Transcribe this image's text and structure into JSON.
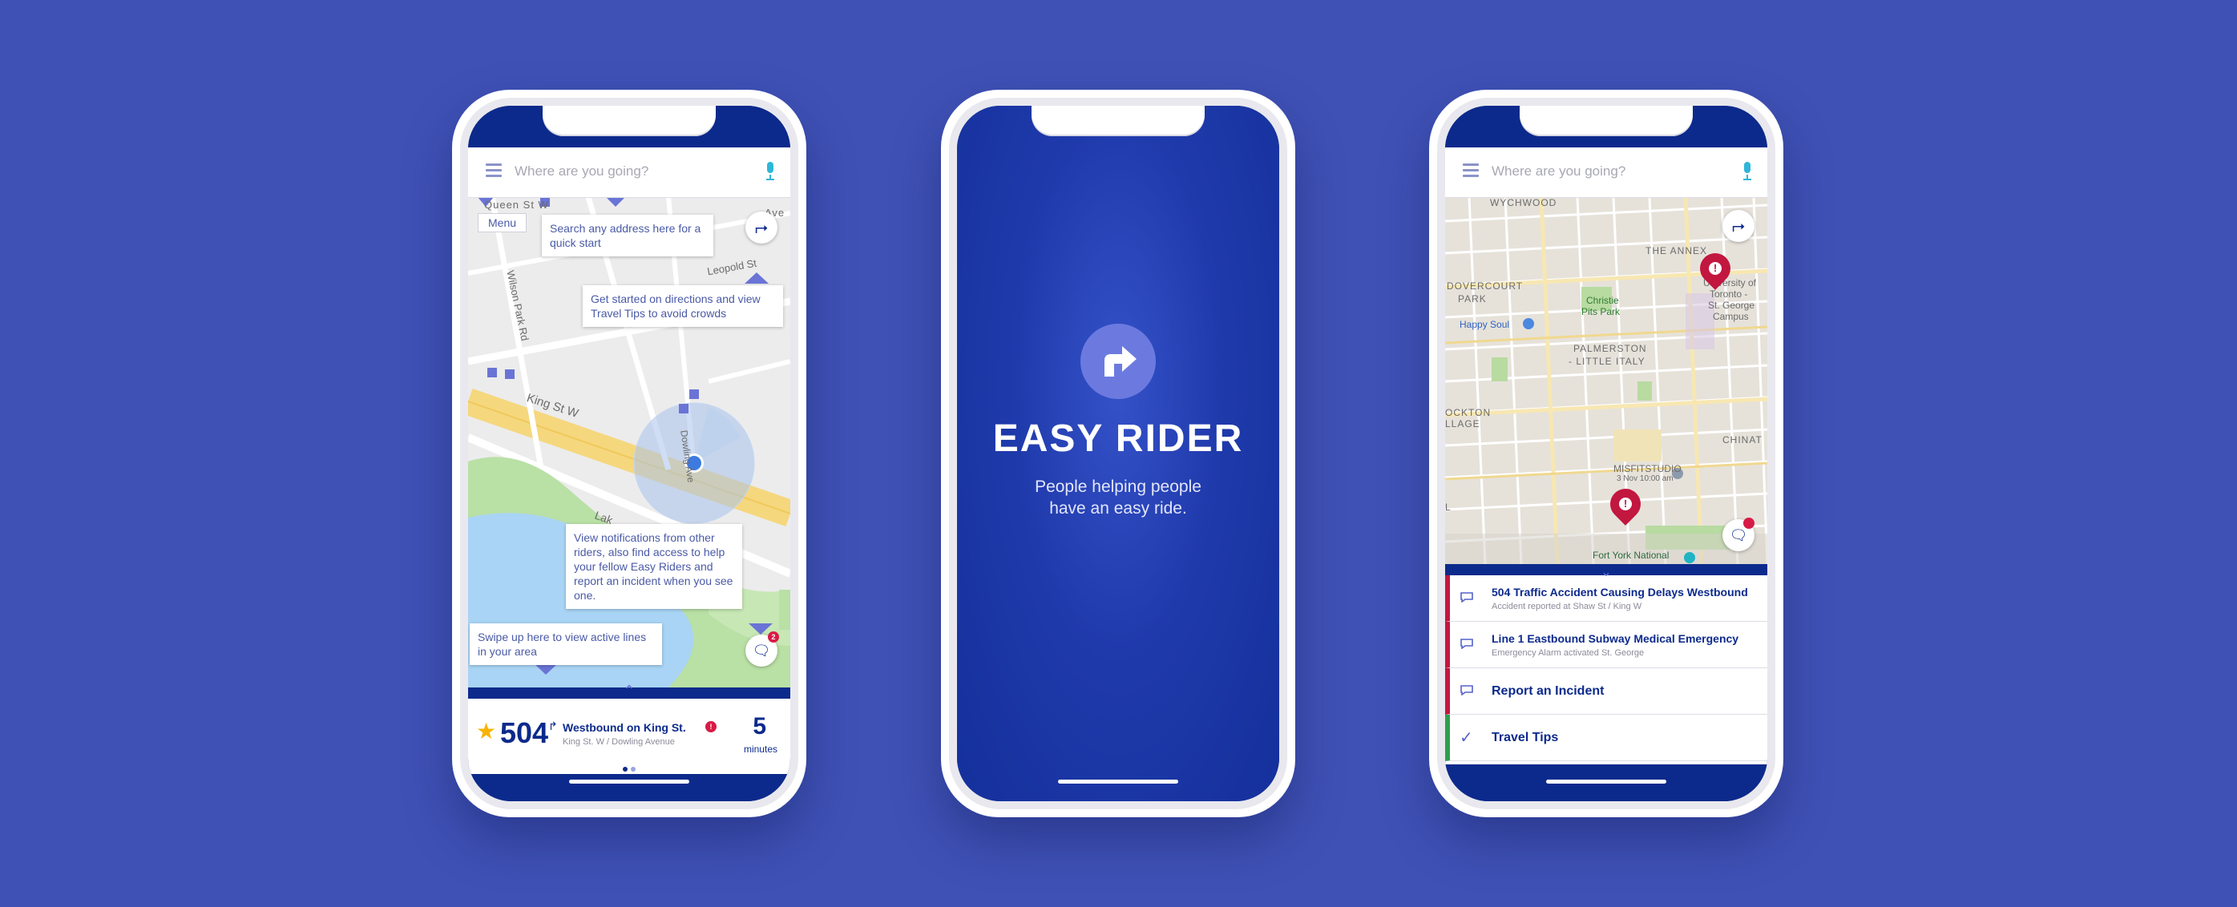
{
  "search": {
    "placeholder": "Where are you going?"
  },
  "phone1": {
    "menu_chip": "Menu",
    "tips": {
      "search": "Search any address here for a quick start",
      "directions": "Get started on directions and view Travel Tips to avoid crowds",
      "notifications": "View notifications from other riders, also find access to help your fellow Easy Riders and report an incident when you see one.",
      "swipe": "Swipe up here to view active lines in your area"
    },
    "streets": {
      "king": "King St W",
      "wilson": "Wilson Park Rd",
      "leopold": "Leopold St",
      "dowling": "Dowling Ave",
      "lake": "Lak",
      "queen": "Queen St W",
      "ave": "Ave"
    },
    "chat_badge": "2",
    "route": {
      "number": "504",
      "direction": "Westbound on King St.",
      "alert": "!",
      "stop": "King St. W / Dowling Avenue",
      "minutes": "5",
      "minutes_label": "minutes"
    }
  },
  "splash": {
    "brand": "EASY RIDER",
    "tagline_line1": "People helping people",
    "tagline_line2": "have an easy ride."
  },
  "phone3": {
    "map_labels": {
      "wychwood": "WYCHWOOD",
      "annex": "THE ANNEX",
      "dovercourt1": "DOVERCOURT",
      "dovercourt2": "PARK",
      "christie1": "Christie",
      "christie2": "Pits Park",
      "happy": "Happy Soul",
      "palmerston1": "PALMERSTON",
      "palmerston2": "- LITTLE ITALY",
      "uoft1": "University of",
      "uoft2": "Toronto -",
      "uoft3": "St. George",
      "uoft4": "Campus",
      "rockton1": "OCKTON",
      "rockton2": "LLAGE",
      "chinat": "CHINAT",
      "misfit1": "MISFITSTUDIO",
      "misfit2": "3 Nov 10:00 am",
      "fortyork": "Fort York National",
      "l": "L"
    },
    "notifications": [
      {
        "title": "504 Traffic Accident Causing Delays Westbound",
        "sub": "Accident reported at Shaw St / King W"
      },
      {
        "title": "Line 1 Eastbound Subway Medical Emergency",
        "sub": "Emergency Alarm activated St. George"
      }
    ],
    "report": "Report an Incident",
    "travel_tips": "Travel Tips",
    "pin_glyph": "!"
  },
  "colors": {
    "background": "#3f51b5",
    "navy": "#0c2a8c",
    "alert": "#c2173f",
    "green": "#2e9e4e",
    "accent": "#6c7ae0"
  },
  "icons": [
    "menu-icon",
    "mic-icon",
    "directions-icon",
    "chat-icon",
    "star-icon",
    "turn-right-icon",
    "check-icon",
    "location-pin-icon",
    "chevron-up-icon",
    "chevron-down-icon"
  ]
}
